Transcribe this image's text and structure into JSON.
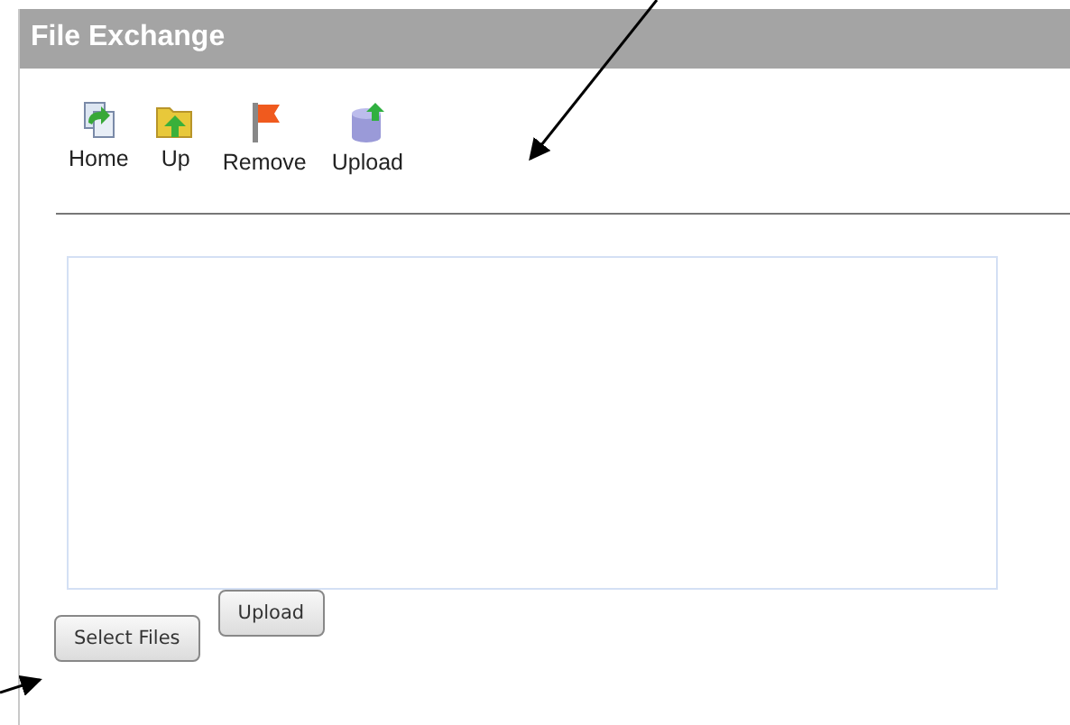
{
  "window": {
    "title": "File Exchange"
  },
  "toolbar": [
    {
      "label": "Home",
      "kind": "home"
    },
    {
      "label": "Up",
      "kind": "up"
    },
    {
      "label": "Remove",
      "kind": "remove"
    },
    {
      "label": "Upload",
      "kind": "upload"
    }
  ],
  "buttons": [
    {
      "label": "Select Files",
      "kind": "select"
    },
    {
      "label": "Upload",
      "kind": "upload"
    }
  ]
}
